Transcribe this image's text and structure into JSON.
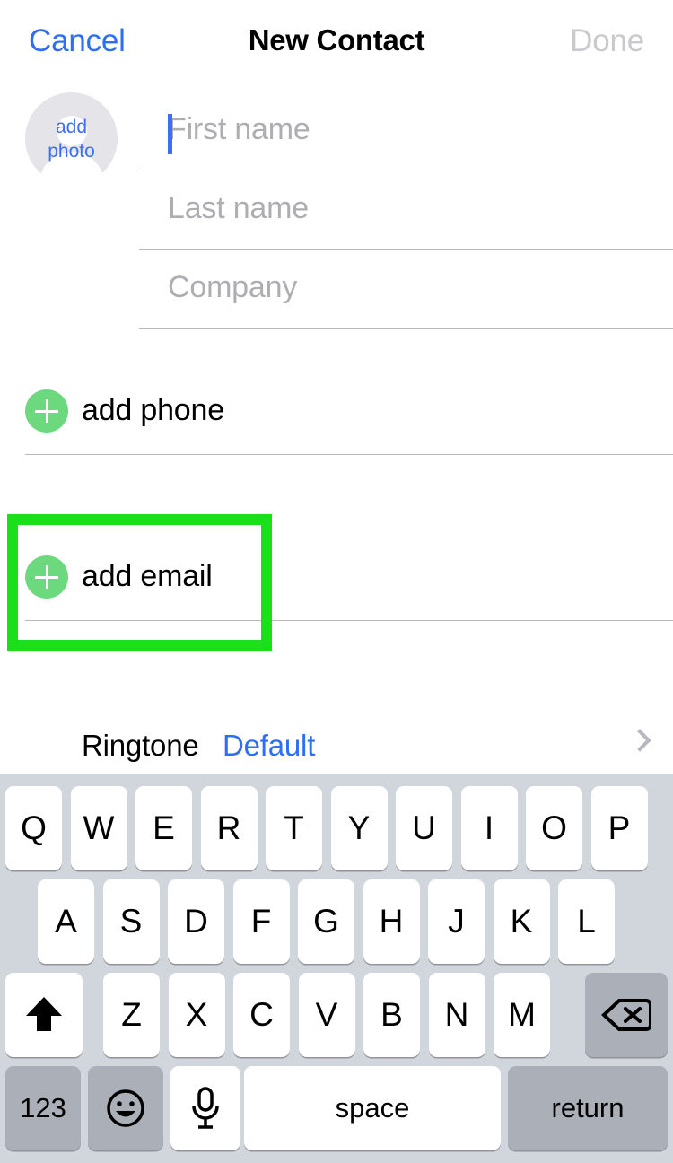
{
  "navbar": {
    "cancel_label": "Cancel",
    "title": "New Contact",
    "done_label": "Done",
    "cancel_color": "#2e6df6",
    "done_color": "#c9c9ce"
  },
  "avatar": {
    "line1": "add",
    "line2": "photo",
    "text_color": "#3b6ef0",
    "circle_color": "#e4e4e9"
  },
  "name_fields": [
    {
      "placeholder": "First name",
      "name": "first-name"
    },
    {
      "placeholder": "Last name",
      "name": "last-name"
    },
    {
      "placeholder": "Company",
      "name": "company"
    }
  ],
  "add_rows": [
    {
      "label": "add phone",
      "icon": "plus-icon",
      "highlighted": false
    },
    {
      "label": "add email",
      "icon": "plus-icon",
      "highlighted": true
    }
  ],
  "accents": {
    "plus_green": "#6cd97e",
    "highlight_green": "#19e019",
    "link_blue": "#2e6df6",
    "placeholder_gray": "#aeaeb2"
  },
  "ringtone": {
    "label": "Ringtone",
    "value": "Default",
    "chevron": "chevron-right-icon"
  },
  "keyboard": {
    "row1": [
      "Q",
      "W",
      "E",
      "R",
      "T",
      "Y",
      "U",
      "I",
      "O",
      "P"
    ],
    "row2": [
      "A",
      "S",
      "D",
      "F",
      "G",
      "H",
      "J",
      "K",
      "L"
    ],
    "row3": [
      "Z",
      "X",
      "C",
      "V",
      "B",
      "N",
      "M"
    ],
    "shift_icon": "shift-icon",
    "backspace_icon": "backspace-icon",
    "numeric_label": "123",
    "emoji_icon": "emoji-icon",
    "dictation_icon": "microphone-icon",
    "space_label": "space",
    "return_label": "return",
    "background": "#d1d5dc"
  }
}
